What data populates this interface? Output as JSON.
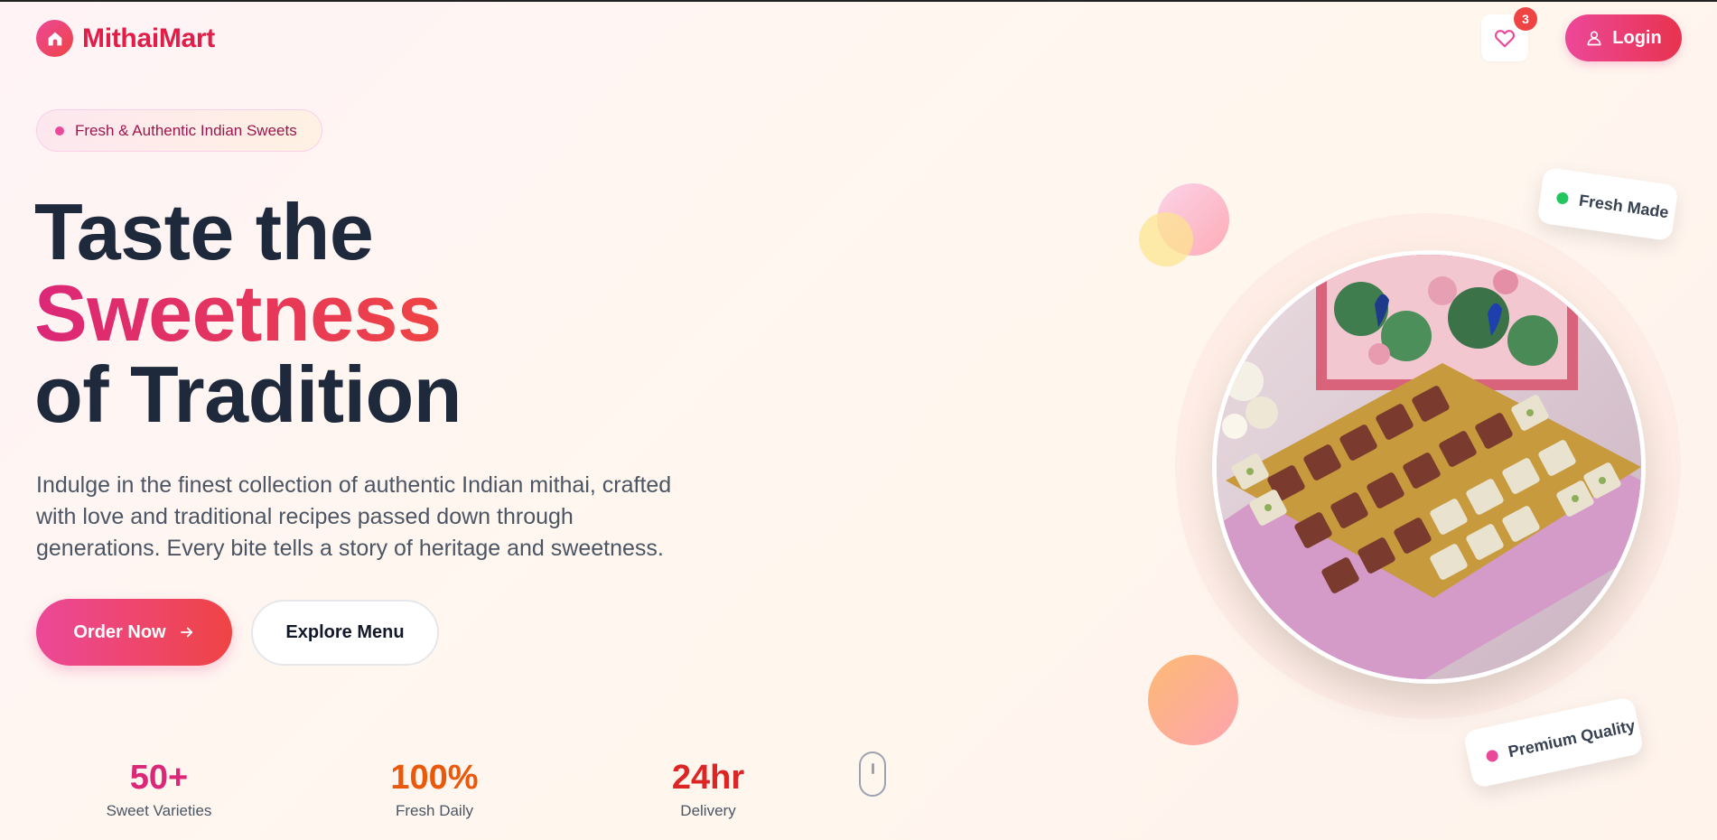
{
  "brand": {
    "name": "MithaiMart"
  },
  "header": {
    "wishlist_count": "3",
    "login_label": "Login"
  },
  "hero": {
    "badge": "Fresh & Authentic Indian Sweets",
    "headline_line1": "Taste the",
    "headline_accent": "Sweetness",
    "headline_line3": "of Tradition",
    "description": "Indulge in the finest collection of authentic Indian mithai, crafted with love and traditional recipes passed down through generations. Every bite tells a story of heritage and sweetness.",
    "order_label": "Order Now",
    "explore_label": "Explore Menu"
  },
  "stats": [
    {
      "value": "50+",
      "label": "Sweet Varieties",
      "color": "#db2777"
    },
    {
      "value": "100%",
      "label": "Fresh Daily",
      "color": "#ea580c"
    },
    {
      "value": "24hr",
      "label": "Delivery",
      "color": "#dc2626"
    }
  ],
  "cards": {
    "fresh": "Fresh Made",
    "premium": "Premium Quality"
  },
  "colors": {
    "brand": "#e11d48",
    "accent_pink": "#ec4899",
    "accent_red": "#ef4444",
    "fresh_dot": "#22c55e"
  },
  "icons": [
    "home-icon",
    "heart-icon",
    "user-icon",
    "arrow-right-icon",
    "mouse-scroll-icon"
  ]
}
